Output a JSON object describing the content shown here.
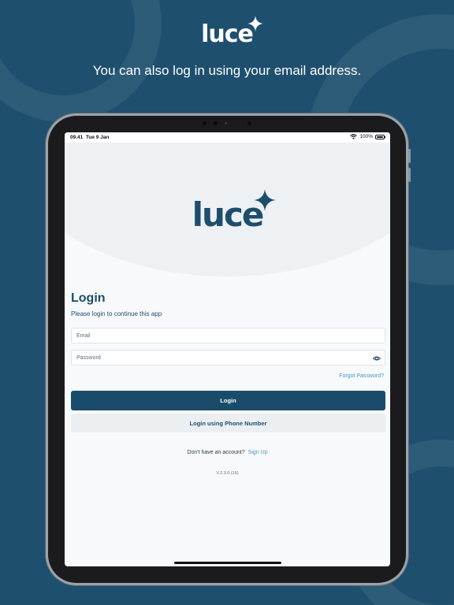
{
  "hero": {
    "logo_text": "luce",
    "tagline": "You can also log in using your email address."
  },
  "status_bar": {
    "time": "09.41",
    "date": "Tue 9 Jan",
    "battery": "100%"
  },
  "app": {
    "logo_text": "luce",
    "login_title": "Login",
    "login_subtitle": "Please login to continue this app",
    "email_placeholder": "Email",
    "password_placeholder": "Password",
    "forgot_password": "Forgot Password?",
    "login_button": "Login",
    "phone_login_button": "Login using Phone Number",
    "no_account_text": "Don't have an account?",
    "sign_up_link": "Sign Up",
    "version": "V.2.3.0 (16)"
  },
  "colors": {
    "background": "#1e4f6e",
    "brand": "#1d4e6c",
    "link": "#4b97c2",
    "primary_button": "#1b4b6b"
  },
  "icons": {
    "logo_spark": "four-point-star-icon",
    "wifi": "wifi-icon",
    "battery": "battery-icon",
    "password_toggle": "eye-icon"
  }
}
